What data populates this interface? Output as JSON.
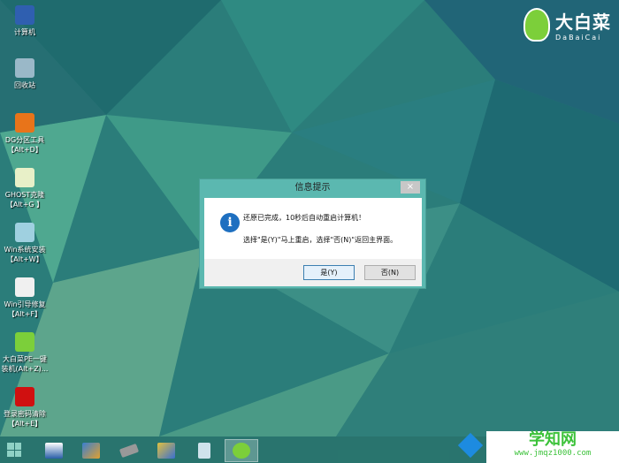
{
  "desktop": {
    "icons": [
      {
        "label": "计算机",
        "color": "#2f5fb0"
      },
      {
        "label": "回收站",
        "color": "#9ab8c8"
      },
      {
        "label": "DG分区工具\n【Alt+D】",
        "color": "#e8741a"
      },
      {
        "label": "GHOST克隆\n【Alt+G 】",
        "color": "#e8f0c8"
      },
      {
        "label": "Win系统安装\n【Alt+W】",
        "color": "#9fd0e0"
      },
      {
        "label": "Win引导修复\n【Alt+F】",
        "color": "#f0f0f0"
      },
      {
        "label": "大白菜PE一键\n装机(Alt+Z)...",
        "color": "#7ccf3a"
      },
      {
        "label": "登录密码清除\n【Alt+E】",
        "color": "#d01010"
      }
    ]
  },
  "logo": {
    "cn": "大白菜",
    "en": "DaBaiCai"
  },
  "dialog": {
    "title": "信息提示",
    "close": "×",
    "message1": "还原已完成，10秒后自动重启计算机！",
    "message2": "选择\"是(Y)\"马上重启，选择\"否(N)\"返回主界面。",
    "yes": "是(Y)",
    "no": "否(N)"
  },
  "taskbar": {
    "items": [
      "network-tool",
      "cleanup-tool",
      "disk-tool",
      "image-tool",
      "notepad",
      "dabaicai"
    ]
  },
  "watermark": {
    "cn": "学知网",
    "url": "www.jmqz1000.com"
  }
}
